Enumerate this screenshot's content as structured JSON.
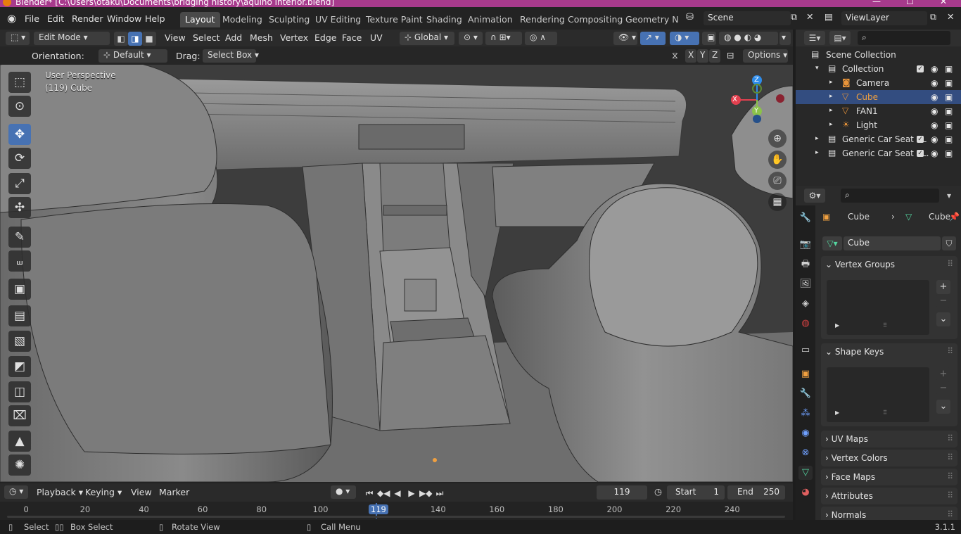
{
  "window": {
    "title": "Blender* [C:\\Users\\otaku\\Documents\\bridging history\\aquino interior.blend]",
    "controls": [
      "—",
      "☐",
      "✕"
    ]
  },
  "menu": {
    "items": [
      "File",
      "Edit",
      "Render",
      "Window",
      "Help"
    ],
    "workspaces": [
      "Layout",
      "Modeling",
      "Sculpting",
      "UV Editing",
      "Texture Paint",
      "Shading",
      "Animation",
      "Rendering",
      "Compositing",
      "Geometry Nod"
    ],
    "active_workspace": "Layout",
    "scene": "Scene",
    "view_layer": "ViewLayer"
  },
  "viewport_header": {
    "mode": "Edit Mode",
    "menus": [
      "View",
      "Select",
      "Add",
      "Mesh",
      "Vertex",
      "Edge",
      "Face",
      "UV"
    ],
    "transform_orientation": "Global",
    "orientation_label": "Orientation:",
    "orientation_value": "Default",
    "drag_label": "Drag:",
    "drag_value": "Select Box",
    "axes": [
      "X",
      "Y",
      "Z"
    ],
    "options": "Options"
  },
  "viewport": {
    "perspective": "User Perspective",
    "object_info": "(119) Cube",
    "gizmo": {
      "x": "X",
      "y": "Y",
      "z": "Z"
    },
    "colors": {
      "x": "#e3404f",
      "y": "#8bc24a",
      "z": "#2d8ceb",
      "accent": "#4772b3"
    }
  },
  "tools": [
    "select-box",
    "cursor",
    "move",
    "rotate",
    "scale",
    "transform",
    "annotate",
    "measure",
    "add-cube",
    "extrude",
    "inset",
    "bevel",
    "loop-cut",
    "knife",
    "poly-build",
    "spin"
  ],
  "tool_glyphs": [
    "⬚",
    "⊙",
    "✥",
    "⟳",
    "⤢",
    "✣",
    "✎",
    "⧢",
    "▣",
    "▤",
    "▧",
    "◩",
    "◫",
    "⌧",
    "▲",
    "✺"
  ],
  "outliner": {
    "root": "Scene Collection",
    "rows": [
      {
        "label": "Collection",
        "indent": 1,
        "icon": "collection-icon",
        "glyph": "▤",
        "checked": true
      },
      {
        "label": "Camera",
        "indent": 2,
        "icon": "camera-icon",
        "glyph": "◙",
        "color": "#e8943a"
      },
      {
        "label": "Cube",
        "indent": 2,
        "icon": "mesh-icon",
        "glyph": "▽",
        "color": "#e8943a",
        "selected": true
      },
      {
        "label": "FAN1",
        "indent": 2,
        "icon": "mesh-icon",
        "glyph": "▽",
        "color": "#e8943a"
      },
      {
        "label": "Light",
        "indent": 2,
        "icon": "light-icon",
        "glyph": "☀",
        "color": "#e8943a"
      },
      {
        "label": "Generic Car Seat PL",
        "indent": 1,
        "icon": "collection-icon",
        "glyph": "▤",
        "checked": true
      },
      {
        "label": "Generic Car Seat PL.",
        "indent": 1,
        "icon": "collection-icon",
        "glyph": "▤",
        "checked": true
      }
    ]
  },
  "properties": {
    "breadcrumb": [
      "Cube",
      "Cube"
    ],
    "data_name": "Cube",
    "panels": [
      "Vertex Groups",
      "Shape Keys",
      "UV Maps",
      "Vertex Colors",
      "Face Maps",
      "Attributes",
      "Normals"
    ]
  },
  "timeline": {
    "menus": [
      "Playback",
      "Keying",
      "View",
      "Marker"
    ],
    "current_frame": "119",
    "start_label": "Start",
    "start": "1",
    "end_label": "End",
    "end": "250",
    "ticks": [
      "0",
      "20",
      "40",
      "60",
      "80",
      "100",
      "119",
      "140",
      "160",
      "180",
      "200",
      "220",
      "240"
    ]
  },
  "status": {
    "hints": [
      "Select",
      "Box Select",
      "Rotate View",
      "Call Menu"
    ],
    "version": "3.1.1"
  }
}
